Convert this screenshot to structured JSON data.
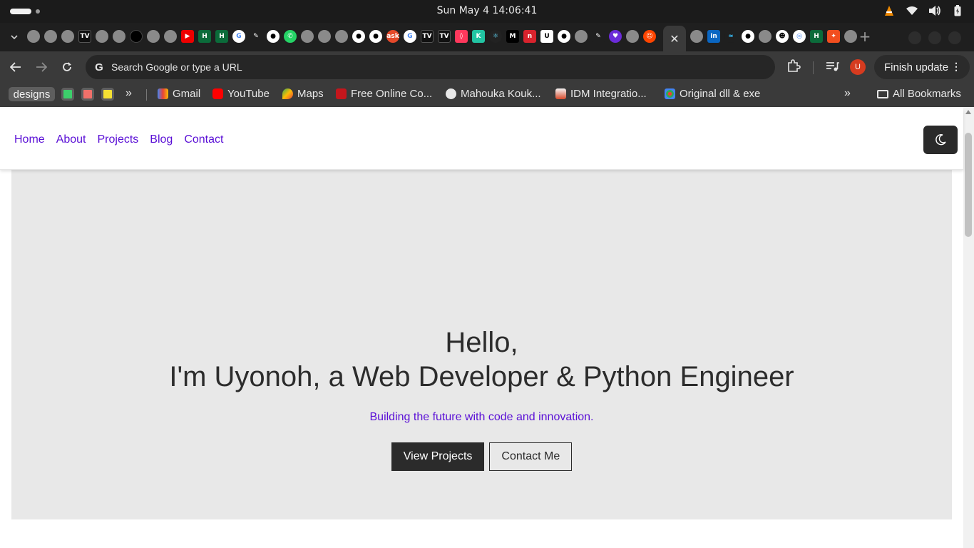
{
  "os_bar": {
    "clock": "Sun May 4  14:06:41"
  },
  "browser": {
    "omnibox_placeholder": "Search Google or type a URL",
    "avatar_initial": "U",
    "finish_update": "Finish update",
    "bookmarks": {
      "designs": "designs",
      "items": [
        "Gmail",
        "YouTube",
        "Maps",
        "Free Online Co...",
        "Mahouka Kouk...",
        "IDM Integratio...",
        "Original dll & exe"
      ],
      "all_bookmarks": "All Bookmarks"
    },
    "tab_favicon_texts": [
      "TV",
      "H",
      "H",
      "ask",
      "TV",
      "TV",
      "K",
      "M",
      "U",
      "in",
      "H"
    ]
  },
  "page": {
    "nav": {
      "home": "Home",
      "about": "About",
      "projects": "Projects",
      "blog": "Blog",
      "contact": "Contact"
    },
    "hero": {
      "greeting": "Hello,",
      "title": "I'm Uyonoh, a Web Developer & Python Engineer",
      "subtitle": "Building the future with code and innovation.",
      "view_projects": "View Projects",
      "contact_me": "Contact Me"
    }
  },
  "colors": {
    "accent_link": "#5a0fd6",
    "hero_bg": "#e8e8e8",
    "dark_button": "#2b2b2b"
  }
}
